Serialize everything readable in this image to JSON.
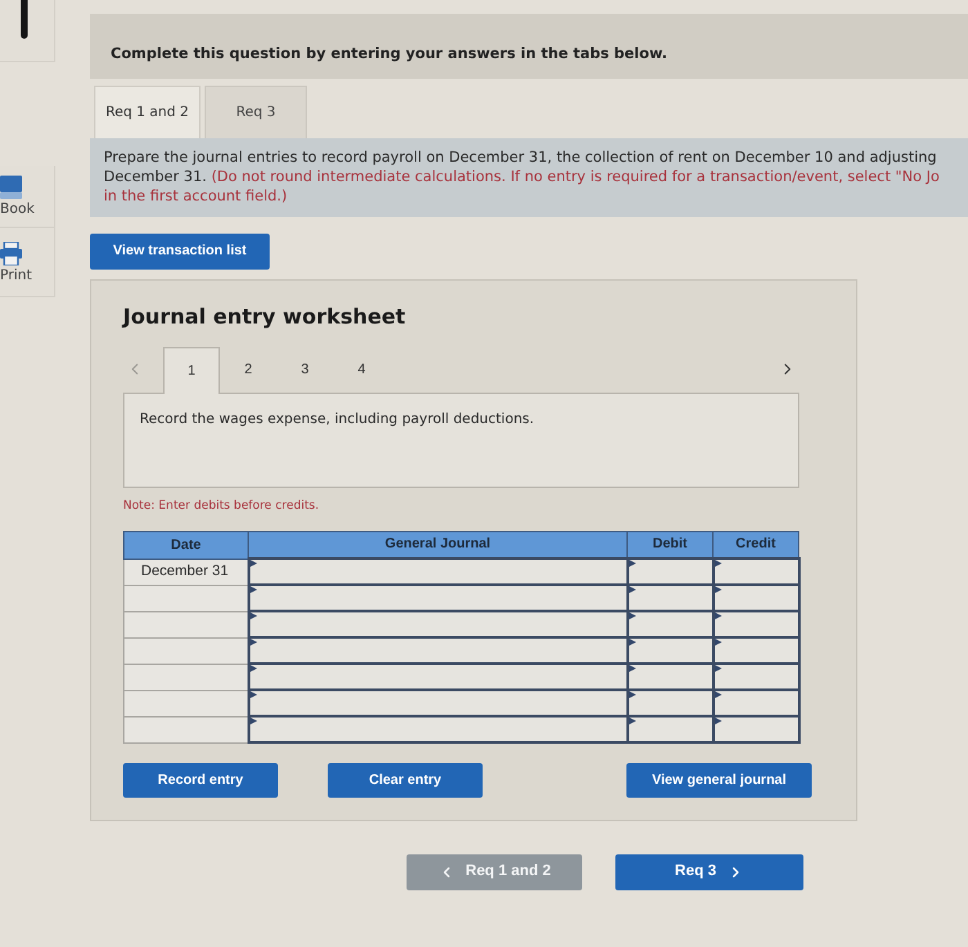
{
  "sidebar": {
    "items": [
      {
        "kind": "book",
        "label": "Book"
      },
      {
        "kind": "print",
        "label": "Print"
      }
    ]
  },
  "header": {
    "text": "Complete this question by entering your answers in the tabs below."
  },
  "tabs": [
    {
      "label": "Req 1 and 2",
      "selected": true
    },
    {
      "label": "Req 3",
      "selected": false
    }
  ],
  "instructions": {
    "text": [
      "Prepare the journal entries to record payroll on December 31, the collection of rent on December 10 and adjusting",
      "December 31."
    ],
    "note": [
      "(Do not round intermediate calculations. If no entry is required for a transaction/event, select \"No Jo",
      "in the first account field.)"
    ]
  },
  "view_transactions_button": "View transaction list",
  "worksheet": {
    "title": "Journal entry worksheet",
    "pager": {
      "prev_disabled": true,
      "next_disabled": false
    },
    "entry_tabs": [
      {
        "label": "1",
        "selected": true
      },
      {
        "label": "2",
        "selected": false
      },
      {
        "label": "3",
        "selected": false
      },
      {
        "label": "4",
        "selected": false
      }
    ],
    "description": "Record the wages expense, including payroll deductions.",
    "note": "Note: Enter debits before credits.",
    "table": {
      "columns": [
        "Date",
        "General Journal",
        "Debit",
        "Credit"
      ],
      "rows": [
        {
          "date": "December 31"
        },
        {},
        {},
        {},
        {},
        {},
        {}
      ]
    },
    "actions": [
      {
        "label": "Record entry"
      },
      {
        "label": "Clear entry"
      },
      {
        "label": "View general journal"
      }
    ]
  },
  "navigation": [
    {
      "kind": "prev",
      "label": "Req 1 and 2",
      "disabled": true
    },
    {
      "kind": "next",
      "label": "Req 3",
      "disabled": false
    }
  ]
}
